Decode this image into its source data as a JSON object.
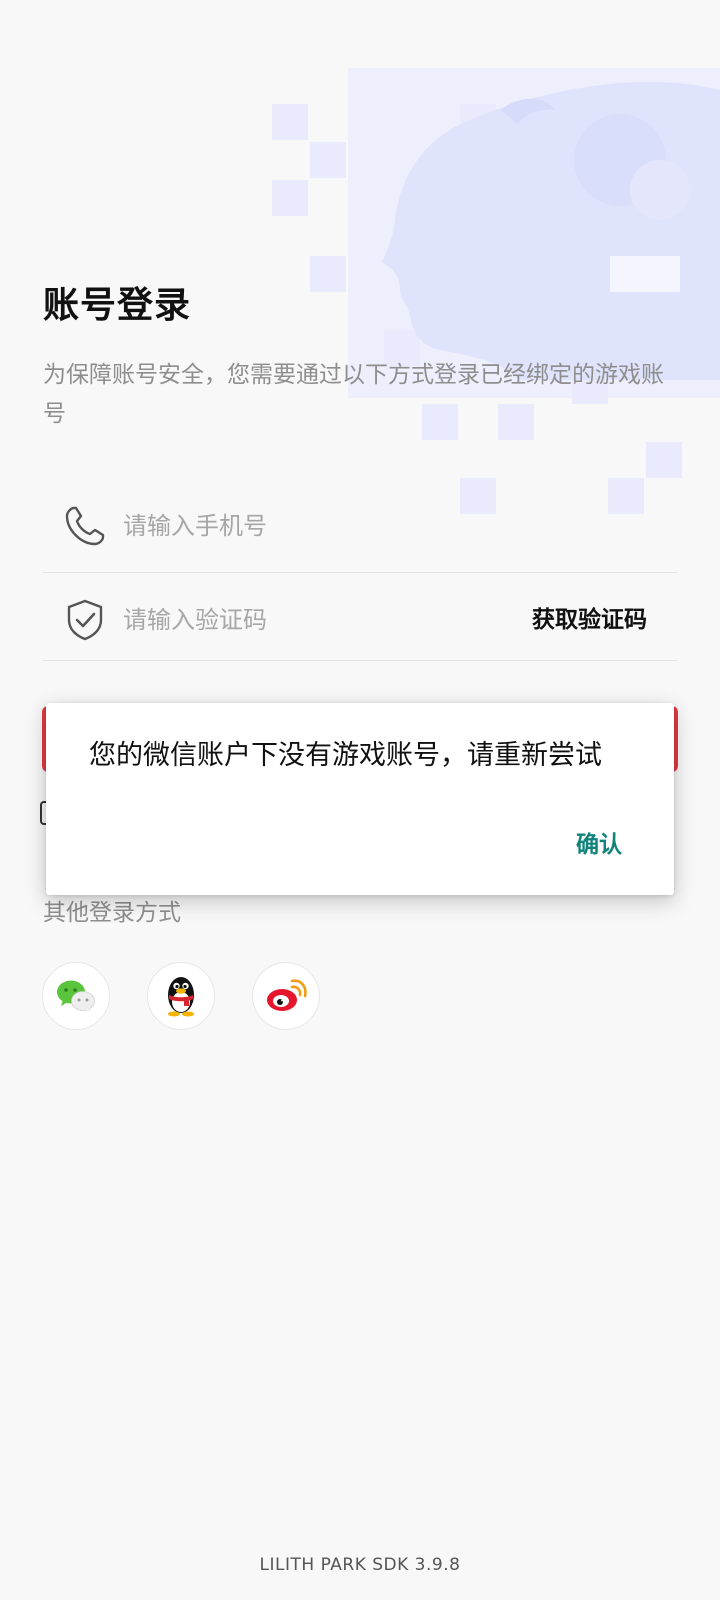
{
  "page": {
    "title": "账号登录",
    "description": "为保障账号安全，您需要通过以下方式登录已经绑定的游戏账号"
  },
  "form": {
    "phone_placeholder": "请输入手机号",
    "code_placeholder": "请输入验证码",
    "get_code_label": "获取验证码",
    "login_label": ""
  },
  "other_login": {
    "title": "其他登录方式",
    "methods": [
      {
        "name": "wechat",
        "icon": "wechat-icon"
      },
      {
        "name": "qq",
        "icon": "qq-penguin-icon"
      },
      {
        "name": "weibo",
        "icon": "weibo-icon"
      }
    ]
  },
  "dialog": {
    "message": "您的微信账户下没有游戏账号，请重新尝试",
    "confirm_label": "确认"
  },
  "footer": {
    "version_text": "LILITH PARK SDK 3.9.8"
  },
  "colors": {
    "background": "#f8f8f8",
    "accent_red": "#e23c45",
    "confirm_teal": "#11837a",
    "muted_text": "#8e8e8e",
    "decor_lavender": "#e8eafc"
  }
}
